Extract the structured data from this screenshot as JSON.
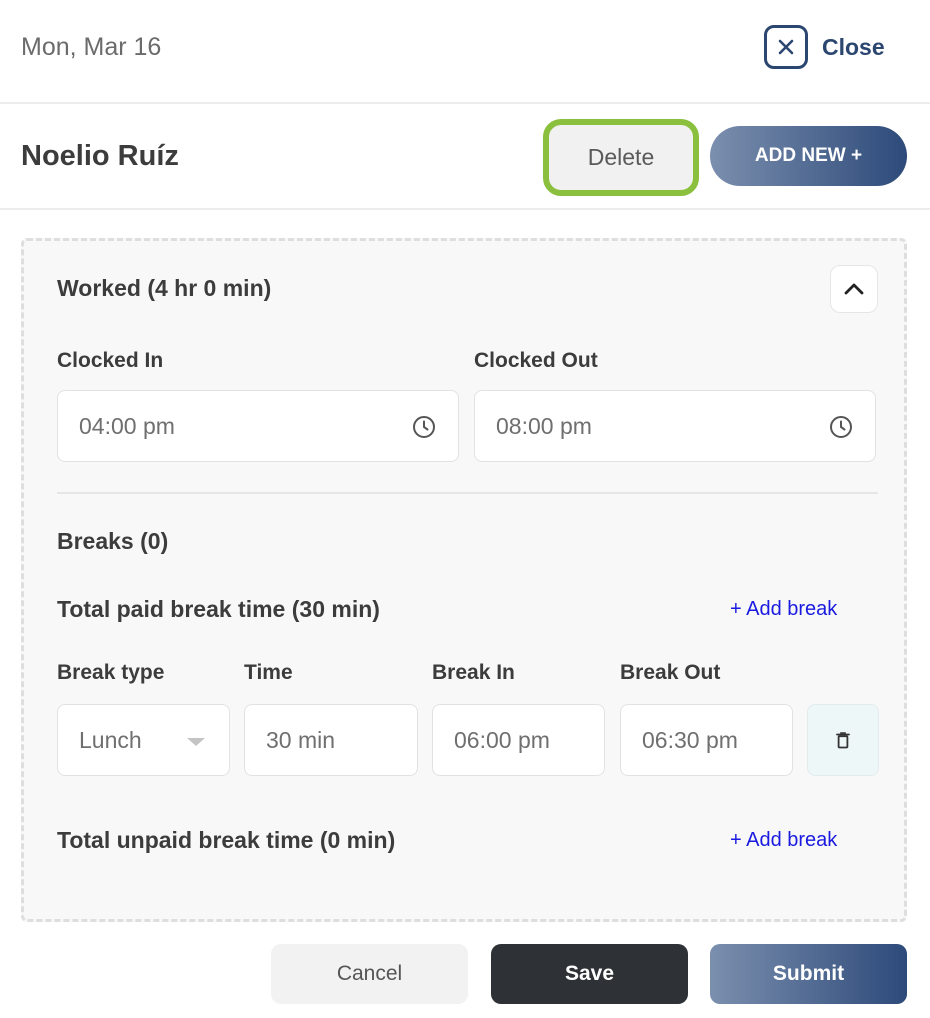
{
  "header": {
    "date": "Mon, Mar 16",
    "close_label": "Close"
  },
  "employee": {
    "name": "Noelio Ruíz",
    "delete_label": "Delete",
    "add_new_label": "ADD NEW +"
  },
  "worked": {
    "title": "Worked (4 hr 0 min)",
    "clocked_in_label": "Clocked In",
    "clocked_in_value": "04:00 pm",
    "clocked_out_label": "Clocked Out",
    "clocked_out_value": "08:00 pm"
  },
  "breaks": {
    "title": "Breaks (0)",
    "paid_title": "Total paid break time (30 min)",
    "add_break_label": "+ Add break",
    "columns": {
      "type": "Break type",
      "time": "Time",
      "in": "Break In",
      "out": "Break Out"
    },
    "row": {
      "type": "Lunch",
      "time": "30 min",
      "in": "06:00 pm",
      "out": "06:30 pm"
    },
    "unpaid_title": "Total unpaid break time (0 min)"
  },
  "footer": {
    "cancel_label": "Cancel",
    "save_label": "Save",
    "submit_label": "Submit"
  },
  "colors": {
    "accent_navy": "#2b4770",
    "highlight_green": "#8ac03e",
    "link_blue": "#1a1ae0",
    "save_dark": "#2e3236"
  },
  "icons": [
    "close-icon",
    "chevron-up-icon",
    "clock-icon",
    "caret-down-icon",
    "trash-icon"
  ]
}
